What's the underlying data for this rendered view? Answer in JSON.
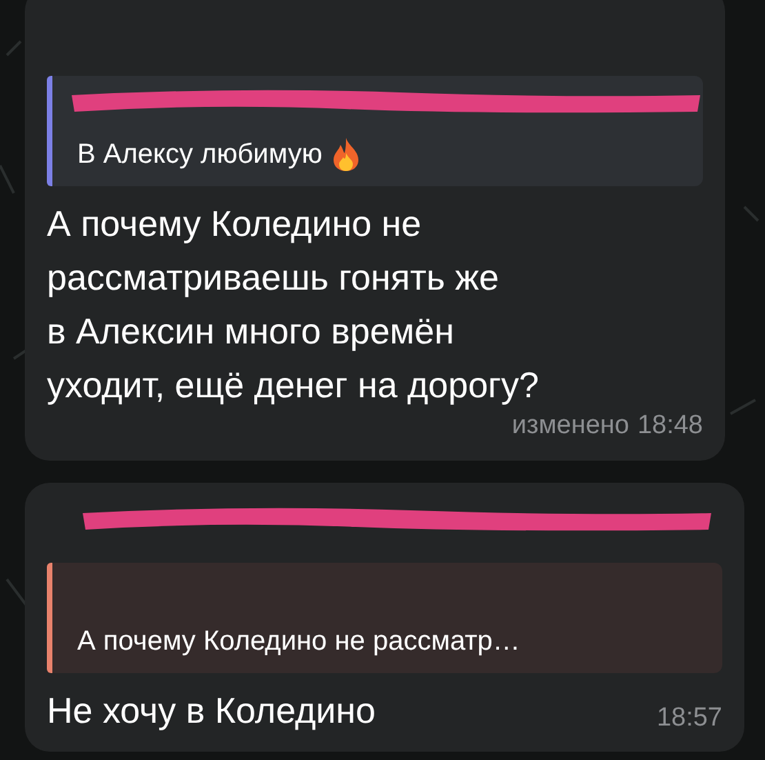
{
  "messages": [
    {
      "reply": {
        "redacted": true,
        "color": "#7c80e6",
        "text": "В Алексу любимую",
        "emoji": true
      },
      "lines": [
        "А почему Коледино не",
        "рассматриваешь гонять же",
        "в Алексин много времён",
        "уходит, ещё денег на дорогу?"
      ],
      "edited_label": "изменено",
      "time": "18:48"
    },
    {
      "reply": {
        "redacted": true,
        "color": "#e8826c",
        "text": "А почему Коледино не рассматр…"
      },
      "lines": [
        "Не хочу в Коледино"
      ],
      "time": "18:57"
    }
  ]
}
